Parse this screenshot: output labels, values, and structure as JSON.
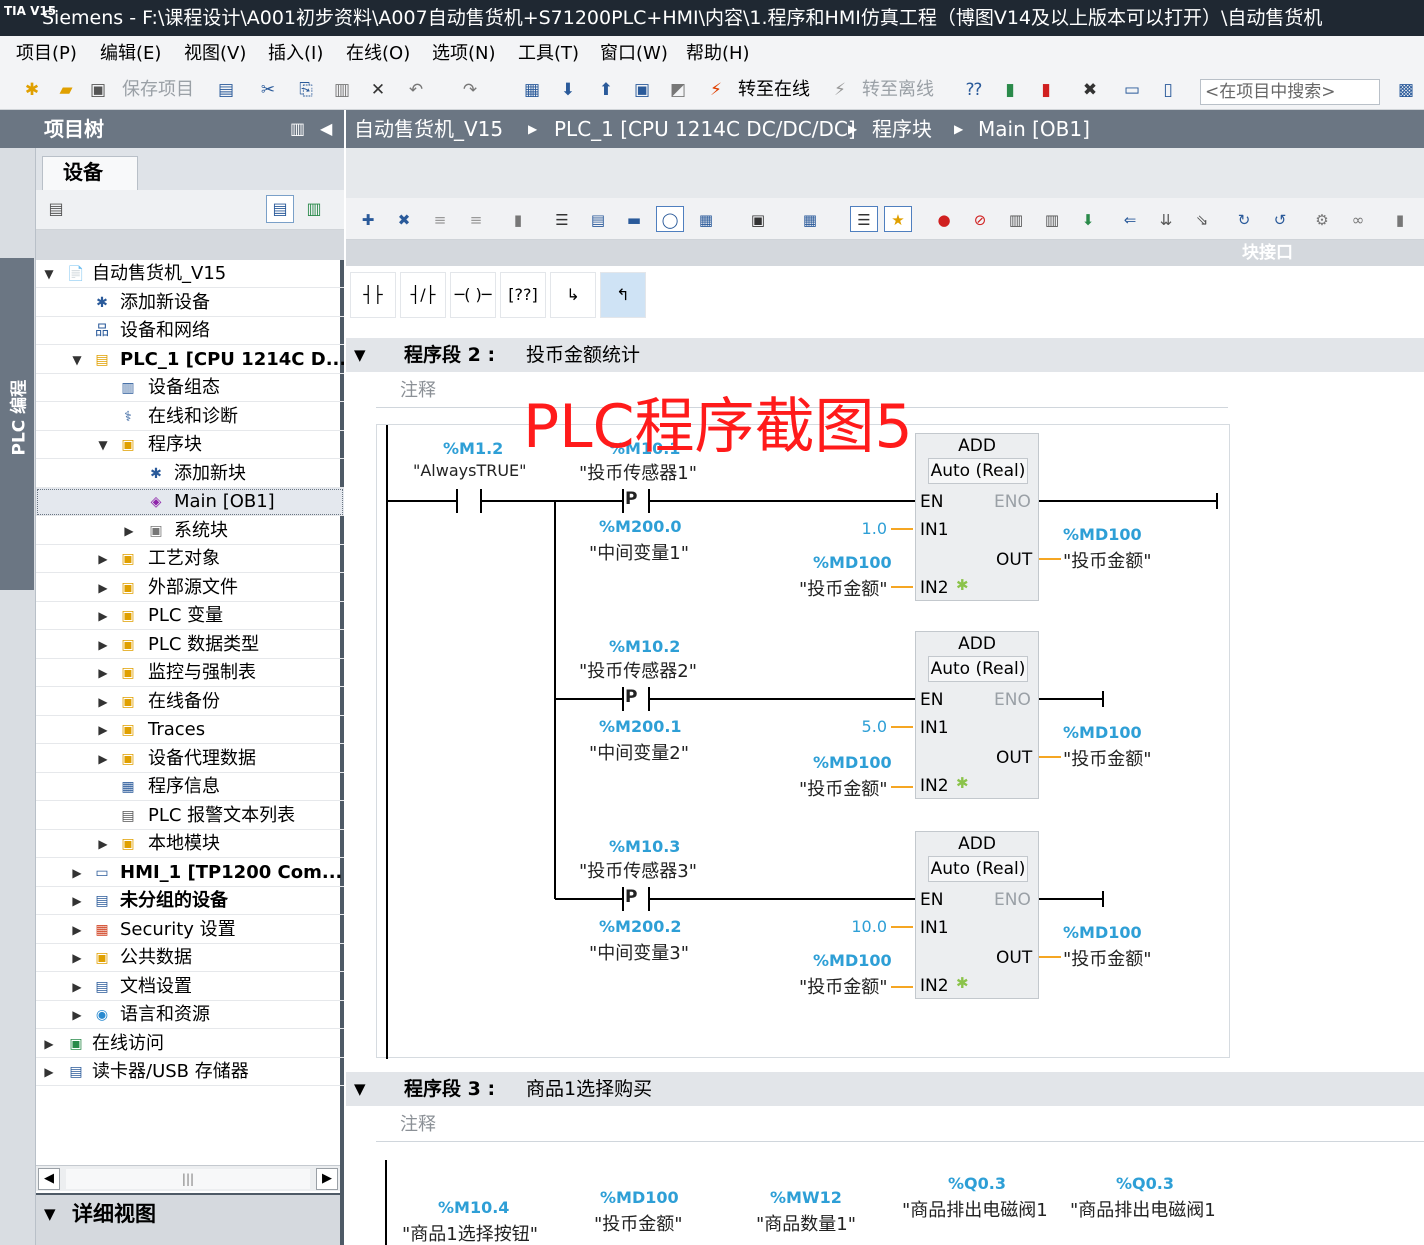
{
  "title_bar": {
    "logo": "TIA\nV15",
    "text": "Siemens  -  F:\\课程设计\\A001初步资料\\A007自动售货机+S71200PLC+HMI\\内容\\1.程序和HMI仿真工程（博图V14及以上版本可以打开）\\自动售货机"
  },
  "menu": [
    "项目(P)",
    "编辑(E)",
    "视图(V)",
    "插入(I)",
    "在线(O)",
    "选项(N)",
    "工具(T)",
    "窗口(W)",
    "帮助(H)"
  ],
  "toolbar": {
    "save_label": "保存项目",
    "go_online": "转至在线",
    "go_offline": "转至离线",
    "search_placeholder": "<在项目中搜索>"
  },
  "side_tab": "PLC 编程",
  "project_tree": {
    "header": "项目树",
    "tab": "设备",
    "items": [
      {
        "label": "自动售货机_V15",
        "icon": "📄",
        "bold": false,
        "twisty": "▼"
      },
      {
        "label": "添加新设备",
        "icon": "✱",
        "bold": false,
        "twisty": ""
      },
      {
        "label": "设备和网络",
        "icon": "品",
        "bold": false,
        "twisty": ""
      },
      {
        "label": "PLC_1 [CPU 1214C D...",
        "icon": "▤",
        "bold": true,
        "twisty": "▼"
      },
      {
        "label": "设备组态",
        "icon": "▥",
        "bold": false,
        "twisty": ""
      },
      {
        "label": "在线和诊断",
        "icon": "⚕",
        "bold": false,
        "twisty": ""
      },
      {
        "label": "程序块",
        "icon": "▣",
        "bold": false,
        "twisty": "▼"
      },
      {
        "label": "添加新块",
        "icon": "✱",
        "bold": false,
        "twisty": ""
      },
      {
        "label": "Main [OB1]",
        "icon": "◈",
        "bold": false,
        "twisty": ""
      },
      {
        "label": "系统块",
        "icon": "▣",
        "bold": false,
        "twisty": "▶"
      },
      {
        "label": "工艺对象",
        "icon": "▣",
        "bold": false,
        "twisty": "▶"
      },
      {
        "label": "外部源文件",
        "icon": "▣",
        "bold": false,
        "twisty": "▶"
      },
      {
        "label": "PLC 变量",
        "icon": "▣",
        "bold": false,
        "twisty": "▶"
      },
      {
        "label": "PLC 数据类型",
        "icon": "▣",
        "bold": false,
        "twisty": "▶"
      },
      {
        "label": "监控与强制表",
        "icon": "▣",
        "bold": false,
        "twisty": "▶"
      },
      {
        "label": "在线备份",
        "icon": "▣",
        "bold": false,
        "twisty": "▶"
      },
      {
        "label": "Traces",
        "icon": "▣",
        "bold": false,
        "twisty": "▶"
      },
      {
        "label": "设备代理数据",
        "icon": "▣",
        "bold": false,
        "twisty": "▶"
      },
      {
        "label": "程序信息",
        "icon": "▦",
        "bold": false,
        "twisty": ""
      },
      {
        "label": "PLC 报警文本列表",
        "icon": "▤",
        "bold": false,
        "twisty": ""
      },
      {
        "label": "本地模块",
        "icon": "▣",
        "bold": false,
        "twisty": "▶"
      },
      {
        "label": "HMI_1 [TP1200 Com...",
        "icon": "▭",
        "bold": true,
        "twisty": "▶"
      },
      {
        "label": "未分组的设备",
        "icon": "▤",
        "bold": true,
        "twisty": "▶"
      },
      {
        "label": "Security 设置",
        "icon": "▦",
        "bold": false,
        "twisty": "▶"
      },
      {
        "label": "公共数据",
        "icon": "▣",
        "bold": false,
        "twisty": "▶"
      },
      {
        "label": "文档设置",
        "icon": "▤",
        "bold": false,
        "twisty": "▶"
      },
      {
        "label": "语言和资源",
        "icon": "◉",
        "bold": false,
        "twisty": "▶"
      },
      {
        "label": "在线访问",
        "icon": "▣",
        "bold": false,
        "twisty": "▶"
      },
      {
        "label": "读卡器/USB 存储器",
        "icon": "▤",
        "bold": false,
        "twisty": "▶"
      }
    ],
    "detail_view": "详细视图"
  },
  "breadcrumb": [
    "自动售货机_V15",
    "PLC_1 [CPU 1214C DC/DC/DC]",
    "程序块",
    "Main [OB1]"
  ],
  "block_interface": "块接口",
  "networks": [
    {
      "title": "程序段 2 :",
      "desc": "投币金额统计",
      "comment": "注释",
      "contact": {
        "op": "%M1.2",
        "sym": "\"AlwaysTRUE\""
      },
      "rungs": [
        {
          "edge_op": "%M10.1",
          "edge_sym": "\"投币传感器1\"",
          "mem_op": "%M200.0",
          "mem_sym": "\"中间变量1\"",
          "block": "ADD",
          "type": "Auto (Real)",
          "in1": "1.0",
          "in2_op": "%MD100",
          "in2_sym": "\"投币金额\"",
          "out_op": "%MD100",
          "out_sym": "\"投币金额\""
        },
        {
          "edge_op": "%M10.2",
          "edge_sym": "\"投币传感器2\"",
          "mem_op": "%M200.1",
          "mem_sym": "\"中间变量2\"",
          "block": "ADD",
          "type": "Auto (Real)",
          "in1": "5.0",
          "in2_op": "%MD100",
          "in2_sym": "\"投币金额\"",
          "out_op": "%MD100",
          "out_sym": "\"投币金额\""
        },
        {
          "edge_op": "%M10.3",
          "edge_sym": "\"投币传感器3\"",
          "mem_op": "%M200.2",
          "mem_sym": "\"中间变量3\"",
          "block": "ADD",
          "type": "Auto (Real)",
          "in1": "10.0",
          "in2_op": "%MD100",
          "in2_sym": "\"投币金额\"",
          "out_op": "%MD100",
          "out_sym": "\"投币金额\""
        }
      ],
      "pins": {
        "en": "EN",
        "eno": "ENO",
        "in1": "IN1",
        "in2": "IN2",
        "out": "OUT",
        "edge": "P"
      }
    },
    {
      "title": "程序段 3 :",
      "desc": "商品1选择购买",
      "comment": "注释",
      "operands": [
        {
          "op": "%M10.4",
          "sym": "\"商品1选择按钮\""
        },
        {
          "op": "%MD100",
          "sym": "\"投币金额\""
        },
        {
          "op": "%MW12",
          "sym": "\"商品数量1\""
        },
        {
          "op": "%Q0.3",
          "sym": "\"商品排出电磁阀1"
        },
        {
          "op": "%Q0.3",
          "sym": "\"商品排出电磁阀1"
        }
      ]
    }
  ],
  "watermark": "PLC程序截图5"
}
